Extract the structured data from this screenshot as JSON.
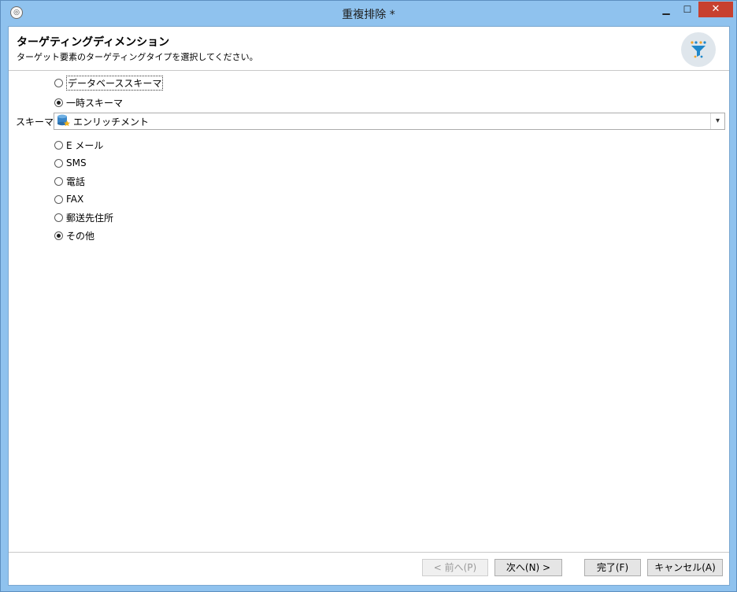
{
  "window": {
    "title": "重複排除 *",
    "app_icon": "adobe-campaign-icon"
  },
  "controls": {
    "minimize_glyph": "▁",
    "maximize_glyph": "☐",
    "close_glyph": "✕"
  },
  "header": {
    "title": "ターゲティングディメンション",
    "subtitle": "ターゲット要素のターゲティングタイプを選択してください。",
    "icon": "funnel-filter-icon"
  },
  "schema_type": {
    "options": [
      {
        "label": "データベーススキーマ",
        "checked": false
      },
      {
        "label": "一時スキーマ",
        "checked": true
      }
    ]
  },
  "schema": {
    "label": "スキーマ:",
    "value": "エンリッチメント",
    "icon": "database-icon"
  },
  "channels": {
    "options": [
      {
        "label": "E メール",
        "checked": false
      },
      {
        "label": "SMS",
        "checked": false
      },
      {
        "label": "電話",
        "checked": false
      },
      {
        "label": "FAX",
        "checked": false
      },
      {
        "label": "郵送先住所",
        "checked": false
      },
      {
        "label": "その他",
        "checked": true
      }
    ]
  },
  "footer": {
    "prev": "< 前へ(P)",
    "next": "次へ(N) >",
    "finish": "完了(F)",
    "cancel": "キャンセル(A)"
  },
  "colors": {
    "titlebar": "#8fc2ee",
    "close_button": "#c7402f",
    "funnel_blue": "#1f87c9",
    "funnel_dots": "#f0a12a"
  }
}
